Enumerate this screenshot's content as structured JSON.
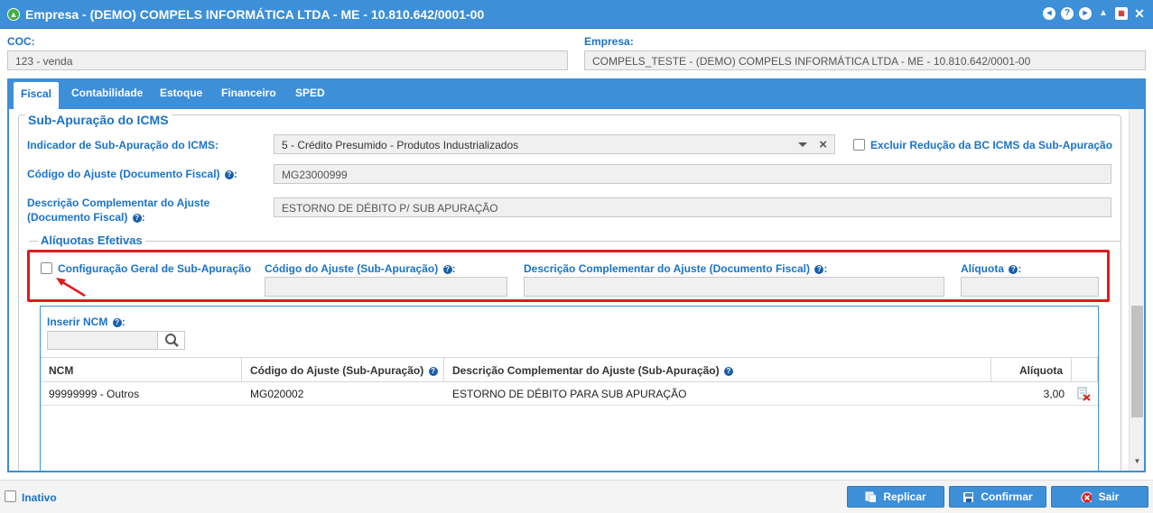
{
  "window": {
    "title": "Empresa - (DEMO) COMPELS INFORMÁTICA LTDA - ME - 10.810.642/0001-00",
    "icons": [
      "back-icon",
      "help-icon",
      "play-icon",
      "user-icon",
      "calendar-icon",
      "close-icon"
    ]
  },
  "header": {
    "coc_label": "COC:",
    "coc_value": "123 - venda",
    "empresa_label": "Empresa:",
    "empresa_value": "COMPELS_TESTE - (DEMO) COMPELS INFORMÁTICA LTDA - ME - 10.810.642/0001-00"
  },
  "tabs": [
    {
      "label": "Fiscal",
      "active": true
    },
    {
      "label": "Contabilidade",
      "active": false
    },
    {
      "label": "Estoque",
      "active": false
    },
    {
      "label": "Financeiro",
      "active": false
    },
    {
      "label": "SPED",
      "active": false
    }
  ],
  "sub_apuracao": {
    "legend": "Sub-Apuração do ICMS",
    "indicador_label": "Indicador de Sub-Apuração do ICMS:",
    "indicador_value": "5 - Crédito Presumido - Produtos Industrializados",
    "excluir_label": "Excluir Redução da BC ICMS da Sub-Apuração",
    "codigo_label": "Código do Ajuste (Documento Fiscal)",
    "codigo_value": "MG23000999",
    "descricao_label_1": "Descrição Complementar do Ajuste",
    "descricao_label_2": "(Documento Fiscal)",
    "descricao_value": "ESTORNO DE DÉBITO P/ SUB APURAÇÃO"
  },
  "aliquotas": {
    "legend": "Alíquotas Efetivas",
    "config_geral_label": "Configuração Geral de Sub-Apuração",
    "codigo_label": "Código do Ajuste (Sub-Apuração)",
    "descricao_label": "Descrição Complementar do Ajuste (Documento Fiscal)",
    "aliquota_label": "Alíquota",
    "colon": ":",
    "codigo_value": "",
    "descricao_value": "",
    "aliquota_value": ""
  },
  "ncm": {
    "inserir_label": "Inserir NCM",
    "colon": ":",
    "search_value": "",
    "columns": [
      "NCM",
      "Código do Ajuste (Sub-Apuração)",
      "Descrição Complementar do Ajuste (Sub-Apuração)",
      "Alíquota"
    ],
    "rows": [
      {
        "ncm": "99999999 - Outros",
        "codigo": "MG020002",
        "descricao": "ESTORNO DE DÉBITO PARA SUB APURAÇÃO",
        "aliquota": "3,00"
      }
    ]
  },
  "footer": {
    "inativo_label": "Inativo",
    "replicar_label": "Replicar",
    "confirmar_label": "Confirmar",
    "sair_label": "Sair"
  },
  "colors": {
    "accent": "#3d8fd8",
    "label_blue": "#1a73c8",
    "highlight_red": "#e01b1b"
  }
}
